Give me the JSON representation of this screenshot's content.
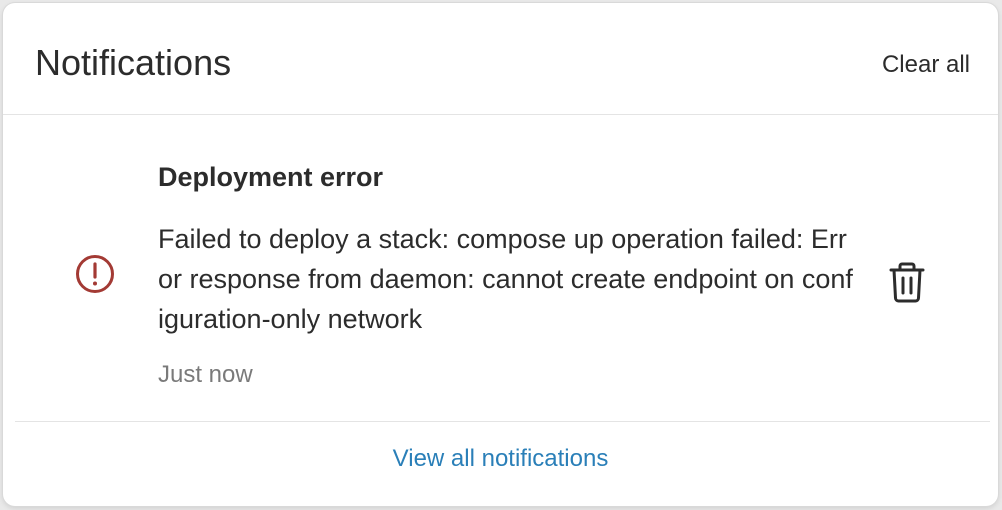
{
  "header": {
    "title": "Notifications",
    "clear_all_label": "Clear all"
  },
  "notifications": [
    {
      "icon": "error-circle-icon",
      "title": "Deployment error",
      "message": "Failed to deploy a stack: compose up operation failed: Error response from daemon: cannot create endpoint on configuration-only network",
      "time": "Just now",
      "delete_icon": "trash-icon"
    }
  ],
  "footer": {
    "view_all_label": "View all notifications"
  },
  "colors": {
    "error": "#a33a34",
    "link": "#2a7fb8",
    "text": "#2c2c2c",
    "muted": "#7a7a7a"
  }
}
